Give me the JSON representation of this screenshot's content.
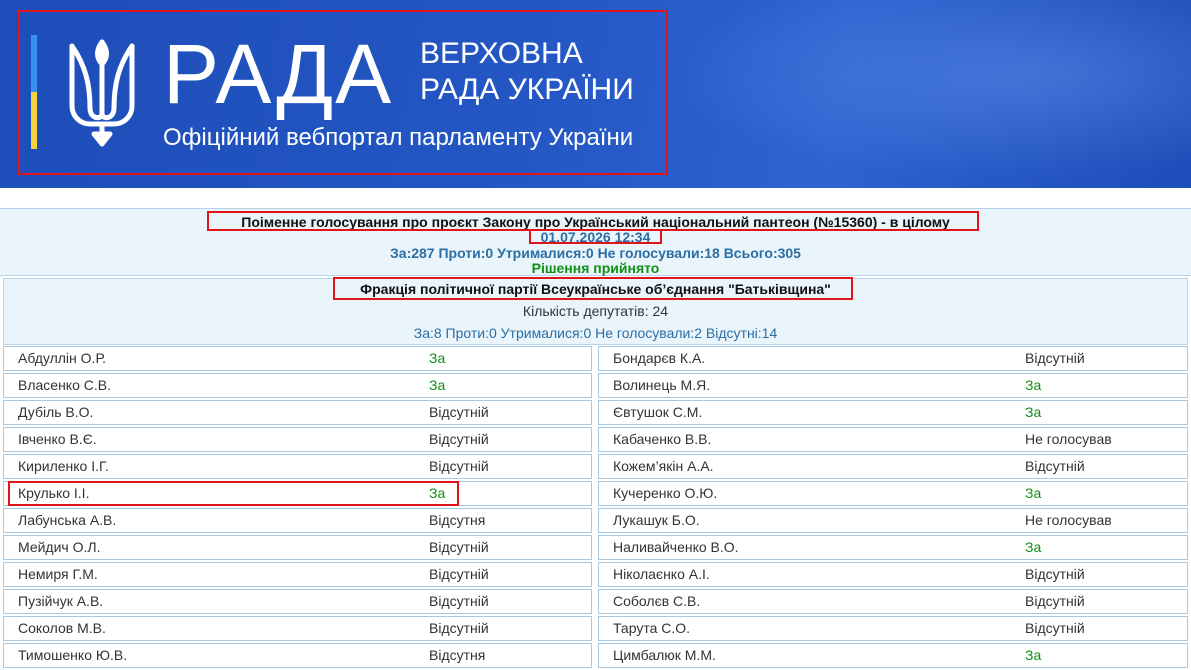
{
  "header": {
    "logo_word": "РАДА",
    "logo_sub_line1": "ВЕРХОВНА",
    "logo_sub_line2": "РАДА УКРАЇНИ",
    "tagline": "Офіційний вебпортал парламенту України",
    "emblem_icon": "trident-icon",
    "colors": {
      "banner": "#2457c4",
      "flag_blue": "#3c8df0",
      "flag_yellow": "#f3d33c"
    }
  },
  "vote": {
    "title": "Поіменне голосування про проєкт Закону про Український національний пантеон (№15360) - в цілому",
    "datetime": "01.07.2026 12:34",
    "counts": "За:287 Проти:0 Утрималися:0 Не голосували:18 Всього:305",
    "decision": "Рішення прийнято"
  },
  "faction": {
    "name": "Фракція політичної партії Всеукраїнське об’єднання \"Батьківщина\"",
    "deputy_count": "Кількість депутатів: 24",
    "votes": "За:8 Проти:0 Утрималися:0 Не голосували:2 Відсутні:14"
  },
  "deputies_left": [
    {
      "name": "Абдуллін О.Р.",
      "vote": "За"
    },
    {
      "name": "Власенко С.В.",
      "vote": "За"
    },
    {
      "name": "Дубіль В.О.",
      "vote": "Відсутній"
    },
    {
      "name": "Івченко В.Є.",
      "vote": "Відсутній"
    },
    {
      "name": "Кириленко І.Г.",
      "vote": "Відсутній"
    },
    {
      "name": "Крулько І.І.",
      "vote": "За"
    },
    {
      "name": "Лабунська А.В.",
      "vote": "Відсутня"
    },
    {
      "name": "Мейдич О.Л.",
      "vote": "Відсутній"
    },
    {
      "name": "Немиря Г.М.",
      "vote": "Відсутній"
    },
    {
      "name": "Пузійчук А.В.",
      "vote": "Відсутній"
    },
    {
      "name": "Соколов М.В.",
      "vote": "Відсутній"
    },
    {
      "name": "Тимошенко Ю.В.",
      "vote": "Відсутня"
    }
  ],
  "deputies_right": [
    {
      "name": "Бондарєв К.А.",
      "vote": "Відсутній"
    },
    {
      "name": "Волинець М.Я.",
      "vote": "За"
    },
    {
      "name": "Євтушок С.М.",
      "vote": "За"
    },
    {
      "name": "Кабаченко В.В.",
      "vote": "Не голосував"
    },
    {
      "name": "Кожем’якін А.А.",
      "vote": "Відсутній"
    },
    {
      "name": "Кучеренко О.Ю.",
      "vote": "За"
    },
    {
      "name": "Лукашук Б.О.",
      "vote": "Не голосував"
    },
    {
      "name": "Наливайченко В.О.",
      "vote": "За"
    },
    {
      "name": "Ніколаєнко А.І.",
      "vote": "Відсутній"
    },
    {
      "name": "Соболєв С.В.",
      "vote": "Відсутній"
    },
    {
      "name": "Тарута С.О.",
      "vote": "Відсутній"
    },
    {
      "name": "Цимбалюк М.М.",
      "vote": "За"
    }
  ],
  "colors": {
    "vote_for": "#109015",
    "link_blue": "#2a6ea6",
    "panel_bg": "#eaf4fb",
    "highlight": "#e0151c"
  }
}
